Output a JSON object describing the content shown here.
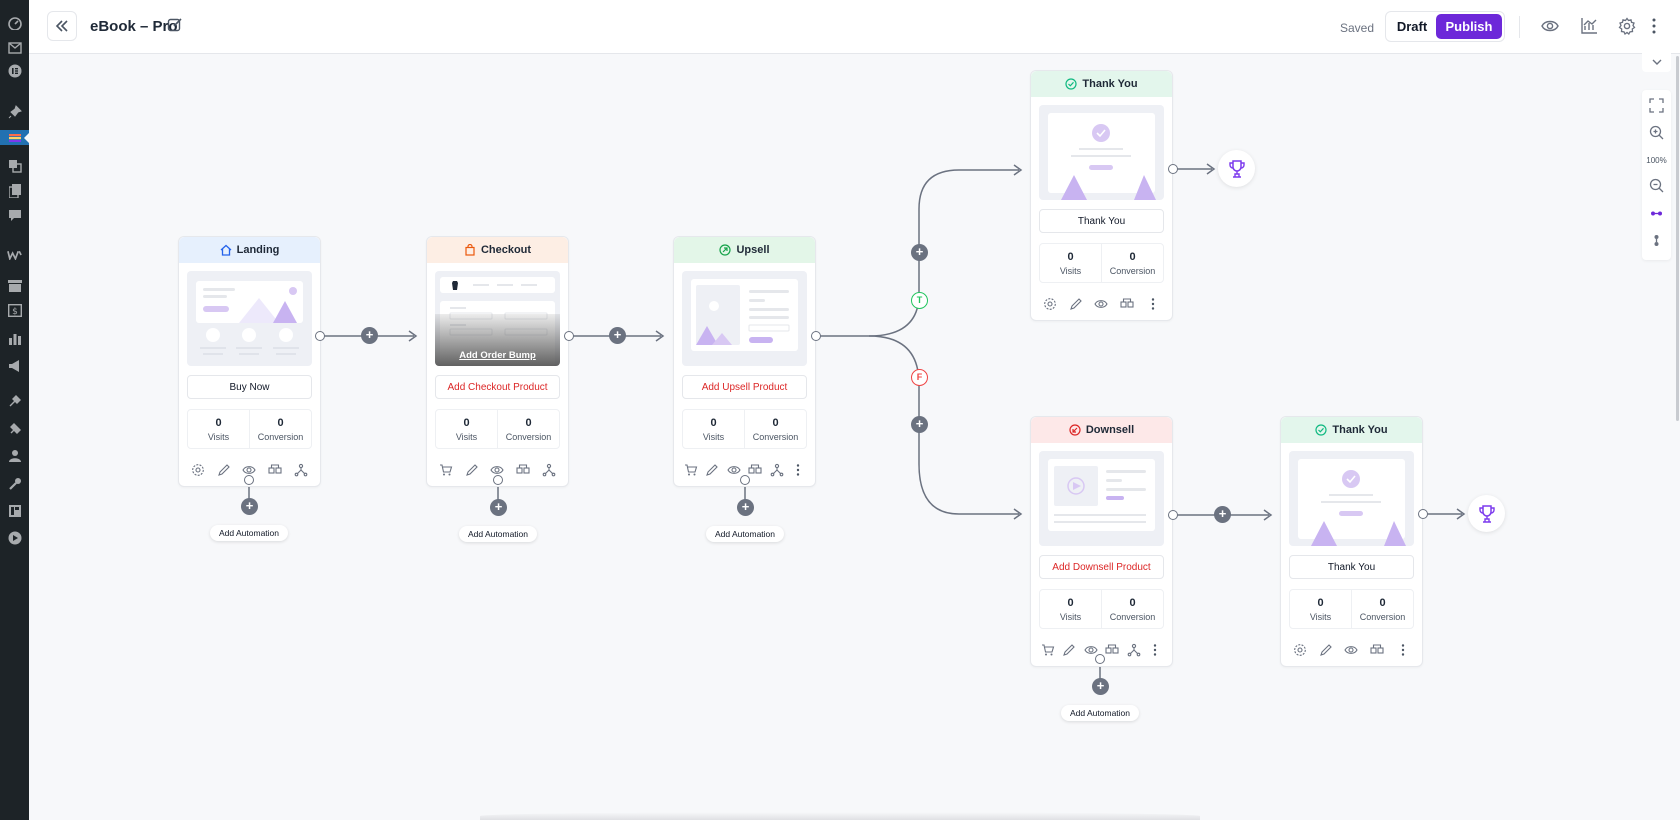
{
  "header": {
    "title": "eBook – Pro",
    "saved": "Saved",
    "draft": "Draft",
    "publish": "Publish"
  },
  "zoom": {
    "level": "100%"
  },
  "steps": {
    "landing": {
      "name": "Landing",
      "title": "Buy Now",
      "visits": "0",
      "visits_label": "Visits",
      "conversion": "0",
      "conversion_label": "Conversion"
    },
    "checkout": {
      "name": "Checkout",
      "title": "Add Checkout Product",
      "order_bump": "Add Order Bump",
      "visits": "0",
      "visits_label": "Visits",
      "conversion": "0",
      "conversion_label": "Conversion"
    },
    "upsell": {
      "name": "Upsell",
      "title": "Add Upsell Product",
      "visits": "0",
      "visits_label": "Visits",
      "conversion": "0",
      "conversion_label": "Conversion"
    },
    "thankyou_top": {
      "name": "Thank You",
      "title": "Thank You",
      "visits": "0",
      "visits_label": "Visits",
      "conversion": "0",
      "conversion_label": "Conversion"
    },
    "downsell": {
      "name": "Downsell",
      "title": "Add Downsell Product",
      "visits": "0",
      "visits_label": "Visits",
      "conversion": "0",
      "conversion_label": "Conversion"
    },
    "thankyou_bottom": {
      "name": "Thank You",
      "title": "Thank You",
      "visits": "0",
      "visits_label": "Visits",
      "conversion": "0",
      "conversion_label": "Conversion"
    }
  },
  "branches": {
    "true": "T",
    "false": "F"
  },
  "automation": {
    "label": "Add Automation"
  },
  "colors": {
    "accent": "#6d28d9",
    "landing_header": "#e6f0fd",
    "checkout_header": "#fdeee4",
    "upsell_header": "#e3f6e8",
    "thankyou_header": "#e3f6ec",
    "downsell_header": "#fde8e8"
  }
}
